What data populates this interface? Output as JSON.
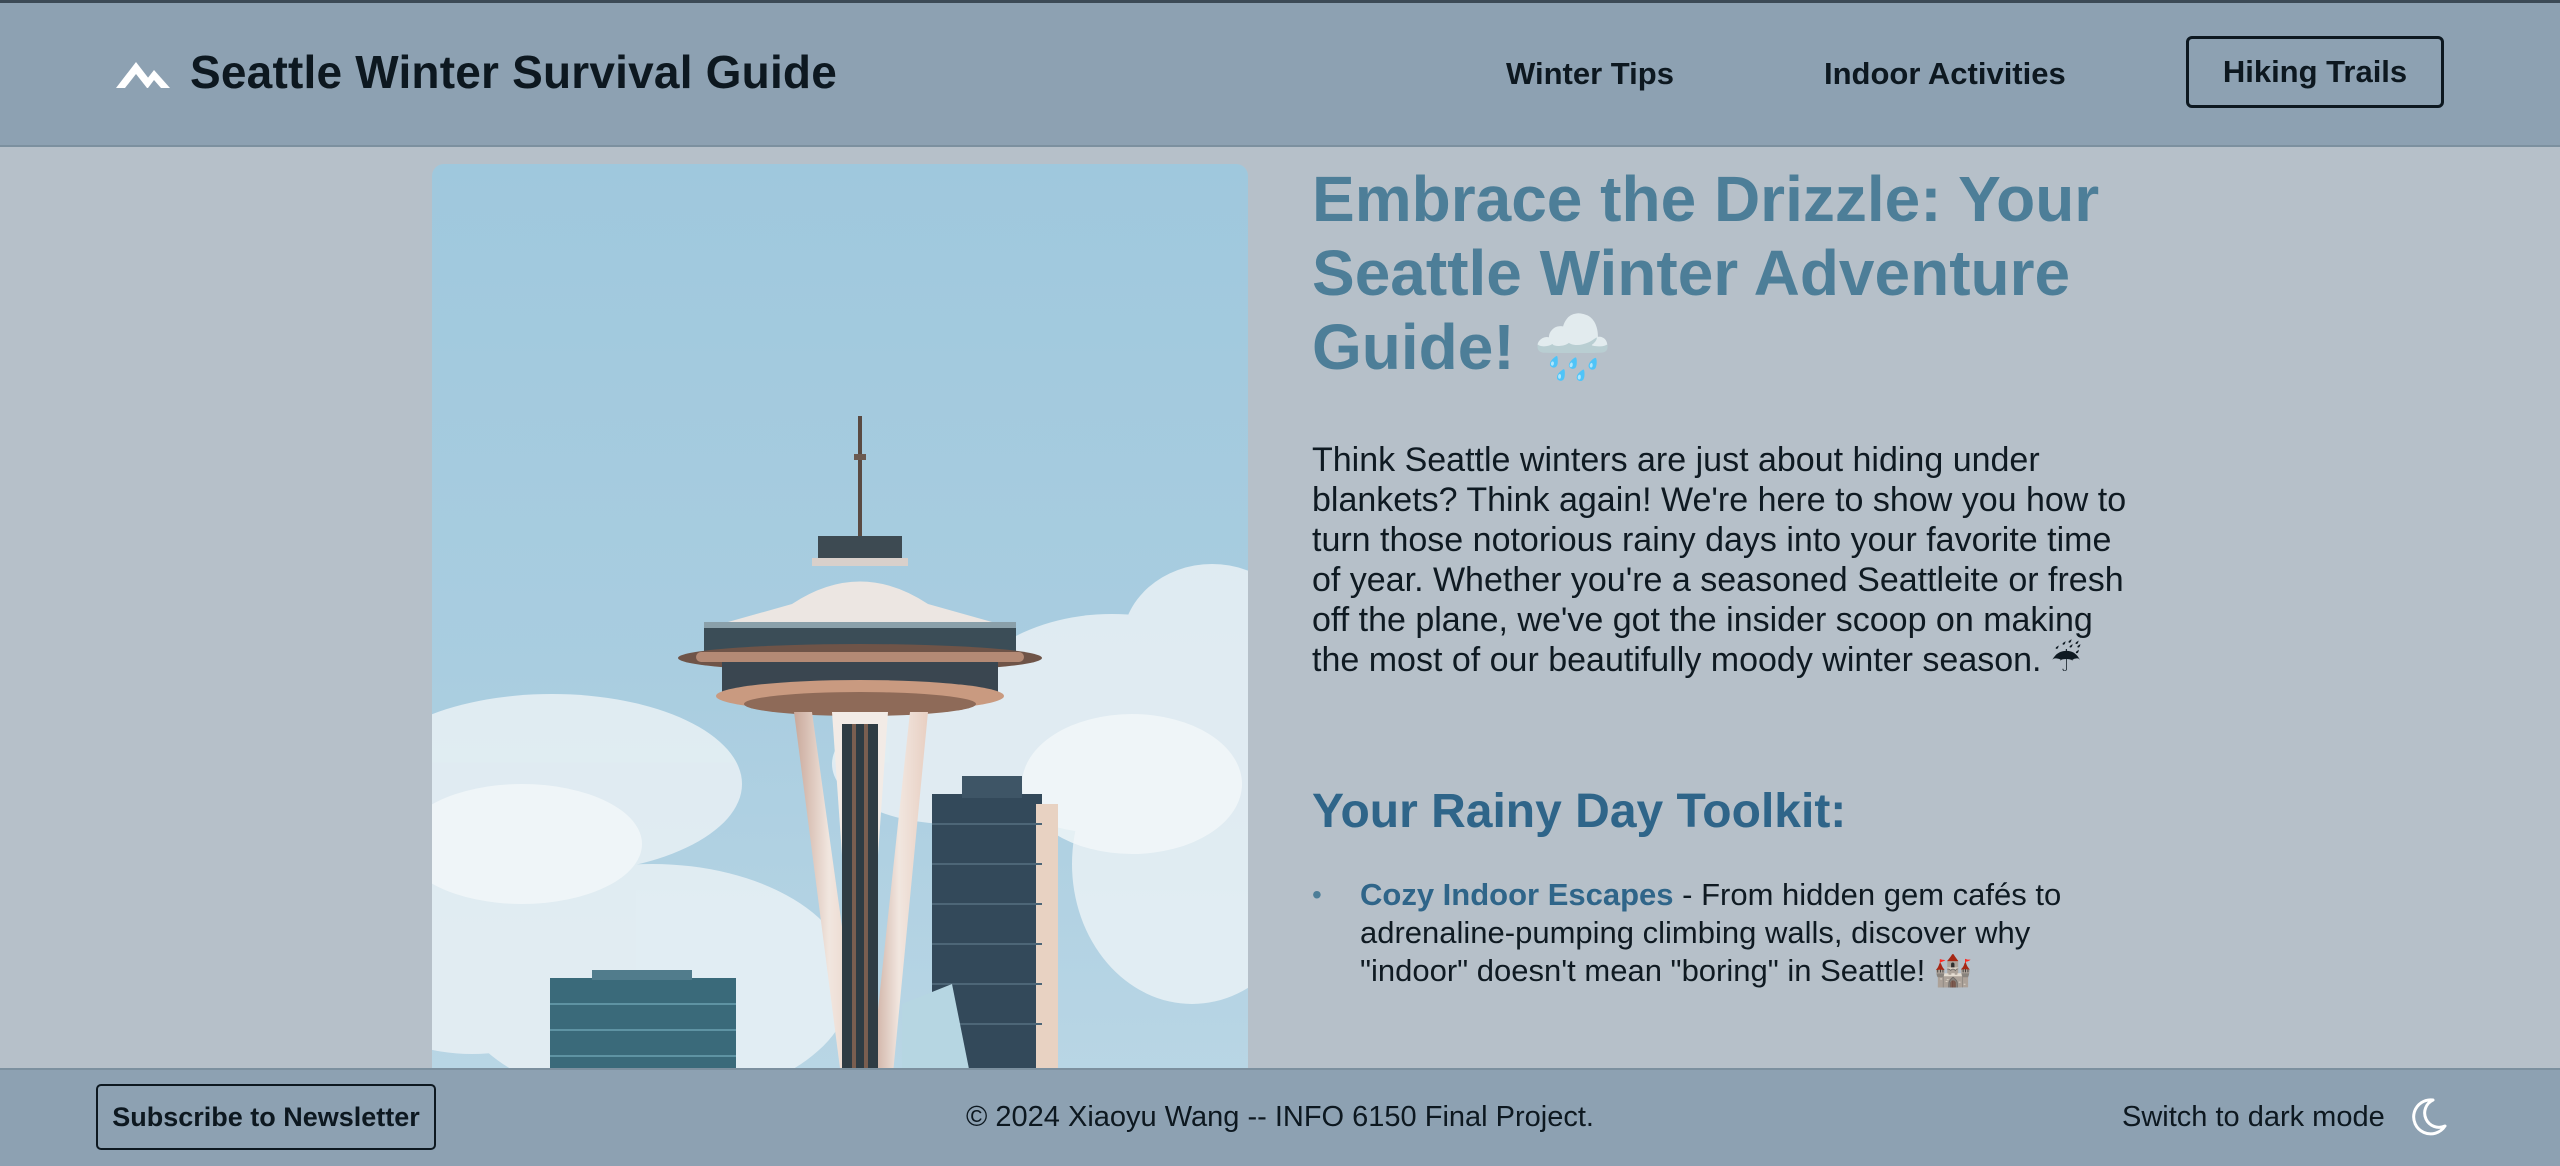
{
  "header": {
    "brand_icon": "mountain-icon",
    "title": "Seattle Winter Survival Guide",
    "nav": [
      "Winter Tips",
      "Indoor Activities"
    ],
    "cta": "Hiking Trails"
  },
  "hero": {
    "image": "space-needle-photo",
    "headline": "Embrace the Drizzle: Your Seattle Winter Adventure Guide! 🌧️",
    "intro": "Think Seattle winters are just about hiding under blankets? Think again! We're here to show you how to turn those notorious rainy days into your favorite time of year. Whether you're a seasoned Seattleite or fresh off the plane, we've got the insider scoop on making the most of our beautifully moody winter season. ☔"
  },
  "toolkit": {
    "title": "Your Rainy Day Toolkit:",
    "items": [
      {
        "link": "Cozy Indoor Escapes",
        "text": " - From hidden gem cafés to adrenaline-pumping climbing walls, discover why \"indoor\" doesn't mean \"boring\" in Seattle! 🏰"
      }
    ]
  },
  "footer": {
    "subscribe": "Subscribe to Newsletter",
    "copyright": "© 2024 Xiaoyu Wang -- INFO 6150 Final Project.",
    "dark_mode": "Switch to dark mode",
    "dark_icon": "moon-icon"
  },
  "colors": {
    "page_bg": "#b6c0c9",
    "header_bg": "#8da1b2",
    "headline": "#4d7e98",
    "accent": "#2f6589"
  }
}
